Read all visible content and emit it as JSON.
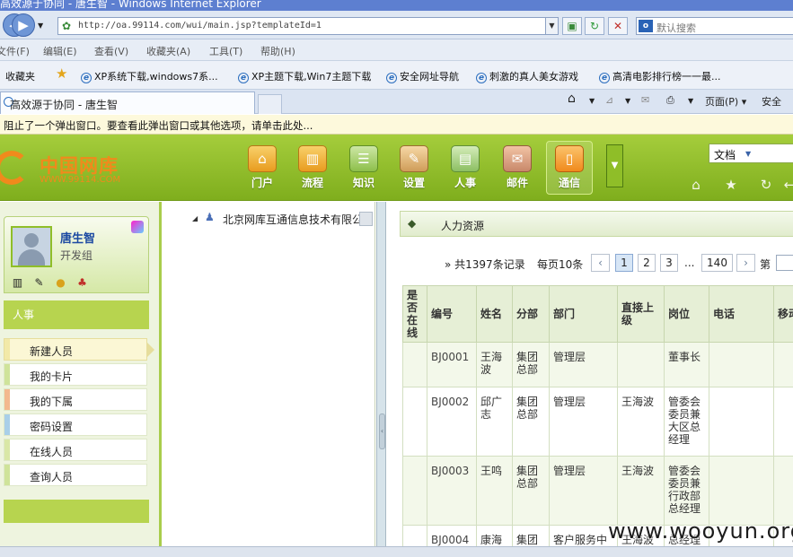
{
  "browser": {
    "window_title": "高效源于协同 - 唐生智 - Windows Internet Explorer",
    "url": "http://oa.99114.com/wui/main.jsp?templateId=1",
    "search_placeholder": "默认搜索",
    "menu": [
      "文件(F)",
      "编辑(E)",
      "查看(V)",
      "收藏夹(A)",
      "工具(T)",
      "帮助(H)"
    ],
    "favorites_label": "收藏夹",
    "favorites": [
      "XP系统下载,windows7系...",
      "XP主题下载,Win7主题下载",
      "安全网址导航",
      "刺激的真人美女游戏",
      "高清电影排行榜一一最..."
    ],
    "tab_title": "高效源于协同 - 唐生智",
    "commands": [
      "页面(P)",
      "安全"
    ],
    "infobar": "阻止了一个弹出窗口。要查看此弹出窗口或其他选项，请单击此处..."
  },
  "header": {
    "logo_cn": "中国网库",
    "logo_en": "WWW.99114.COM",
    "nav": [
      "门户",
      "流程",
      "知识",
      "设置",
      "人事",
      "邮件",
      "通信"
    ],
    "active_nav": "通信",
    "doc_select": "文档"
  },
  "user": {
    "name": "唐生智",
    "dept": "开发组"
  },
  "sidebar": {
    "section_title": "人事",
    "items": [
      {
        "label": "新建人员",
        "color": "#f2e9a8"
      },
      {
        "label": "我的卡片",
        "color": "#cfe39a"
      },
      {
        "label": "我的下属",
        "color": "#f3b88e"
      },
      {
        "label": "密码设置",
        "color": "#a9cfe8"
      },
      {
        "label": "在线人员",
        "color": "#d9e7a6"
      },
      {
        "label": "查询人员",
        "color": "#cfe39a"
      }
    ]
  },
  "tree": {
    "root": "北京网库互通信息技术有限公司"
  },
  "main": {
    "title": "人力资源",
    "pager": {
      "total": "» 共1397条记录",
      "per_page": "每页10条",
      "pages": [
        "1",
        "2",
        "3"
      ],
      "ellipsis": "...",
      "last": "140",
      "goto": "第"
    },
    "columns": [
      "是否在线",
      "编号",
      "姓名",
      "分部",
      "部门",
      "直接上级",
      "岗位",
      "电话",
      "移动"
    ],
    "rows": [
      {
        "online": "",
        "code": "BJ0001",
        "name": "王海波",
        "branch": "集团总部",
        "dept": "管理层",
        "manager": "",
        "post": "董事长",
        "phone": "",
        "mobile": ""
      },
      {
        "online": "",
        "code": "BJ0002",
        "name": "邱广志",
        "branch": "集团总部",
        "dept": "管理层",
        "manager": "王海波",
        "post": "管委会委员兼大区总经理",
        "phone": "",
        "mobile": ""
      },
      {
        "online": "",
        "code": "BJ0003",
        "name": "王鸣",
        "branch": "集团总部",
        "dept": "管理层",
        "manager": "王海波",
        "post": "管委会委员兼行政部总经理",
        "phone": "",
        "mobile": ""
      },
      {
        "online": "",
        "code": "BJ0004",
        "name": "康海",
        "branch": "集团",
        "dept": "客户服务中",
        "manager": "王海波",
        "post": "总经理",
        "phone": "",
        "mobile": ""
      }
    ]
  },
  "watermark": "www.wooyun.org"
}
